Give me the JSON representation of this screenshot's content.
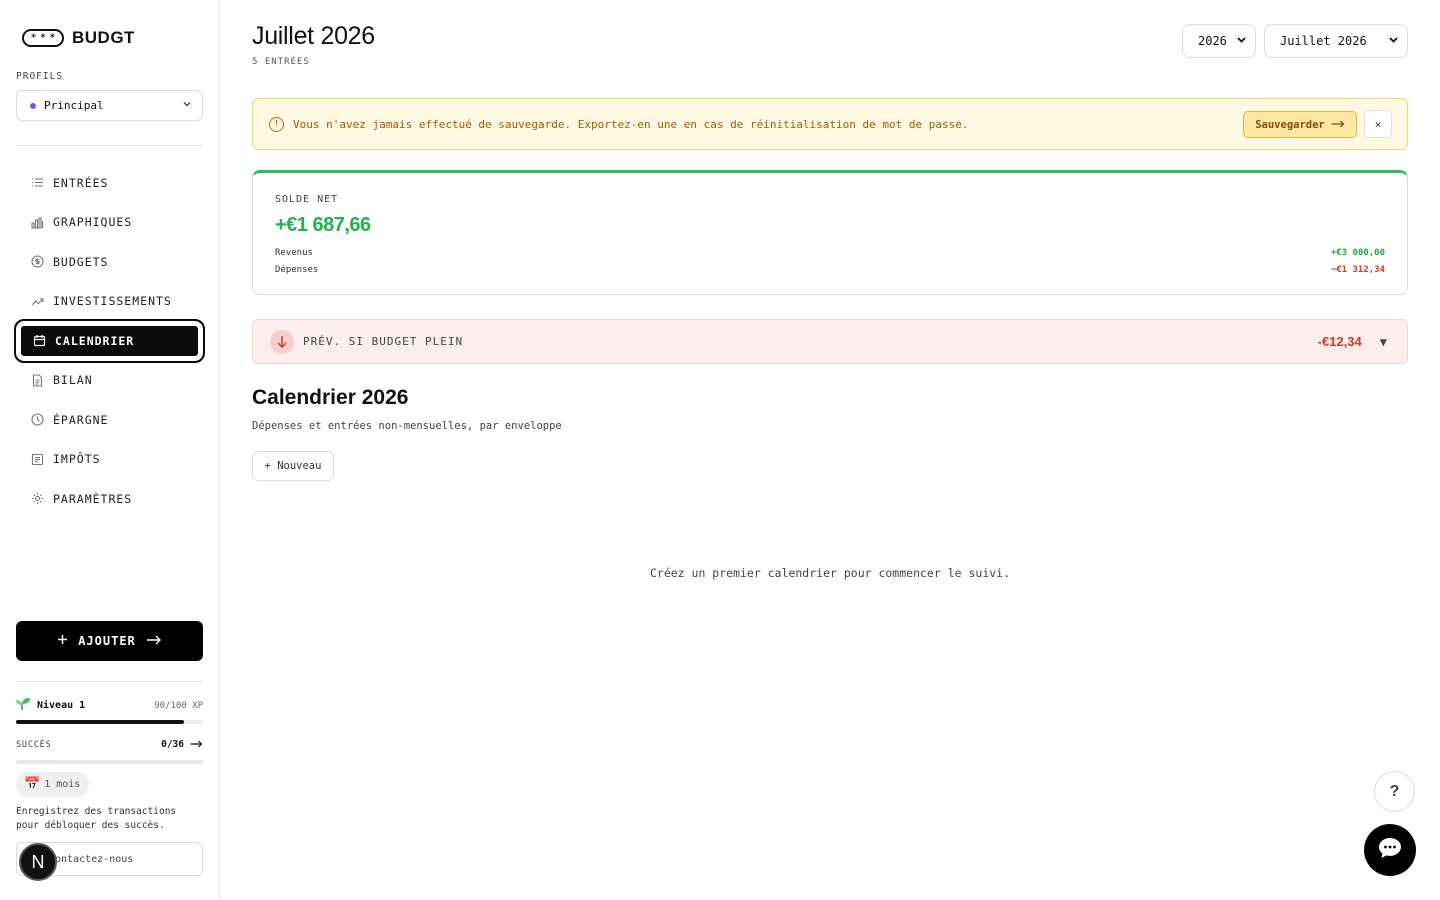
{
  "brand": {
    "logo_dots": "*",
    "name": "BUDGT"
  },
  "sidebar": {
    "profiles_label": "PROFILS",
    "profile": {
      "selected": "Principal",
      "dot_color": "#6d5ce8"
    },
    "items": [
      {
        "label": "ENTRÉES",
        "icon": "list-icon"
      },
      {
        "label": "GRAPHIQUES",
        "icon": "bar-chart-icon"
      },
      {
        "label": "BUDGETS",
        "icon": "coin-icon"
      },
      {
        "label": "INVESTISSEMENTS",
        "icon": "trending-up-icon"
      },
      {
        "label": "CALENDRIER",
        "icon": "calendar-icon",
        "active": true
      },
      {
        "label": "BILAN",
        "icon": "document-icon"
      },
      {
        "label": "ÉPARGNE",
        "icon": "clock-icon"
      },
      {
        "label": "IMPÔTS",
        "icon": "receipt-icon"
      },
      {
        "label": "PARAMÈTRES",
        "icon": "gear-icon"
      }
    ],
    "add_label": "AJOUTER",
    "level": {
      "label": "Niveau 1",
      "xp_text": "90/100 XP",
      "progress": 0.9
    },
    "achievements": {
      "label": "SUCCÈS",
      "count": "0/36",
      "progress": 0.0
    },
    "streak": {
      "icon": "📅",
      "label": "1 mois"
    },
    "achievement_hint": "Enregistrez des transactions pour débloquer des succès.",
    "contact": "Contactez-nous",
    "badge_letter": "N"
  },
  "header": {
    "title": "Juillet 2026",
    "entries_count": "5 ENTRÉES",
    "year_select": "2026",
    "month_select": "Juillet 2026"
  },
  "warning": {
    "text": "Vous n'avez jamais effectué de sauvegarde. Exportez-en une en cas de réinitialisation de mot de passe.",
    "button": "Sauvegarder",
    "close": "×"
  },
  "balance": {
    "label": "SOLDE NET",
    "value": "+€1 687,66",
    "revenue_label": "Revenus",
    "revenue_value": "+€3 000,00",
    "expense_label": "Dépenses",
    "expense_value": "−€1 312,34",
    "accent_color": "#2fbf5b"
  },
  "forecast": {
    "label": "PRÉV. SI BUDGET PLEIN",
    "value": "-€12,34"
  },
  "calendar": {
    "title": "Calendrier 2026",
    "subtitle": "Dépenses et entrées non-mensuelles, par enveloppe",
    "new_button": "+ Nouveau",
    "empty_message": "Créez un premier calendrier pour commencer le suivi."
  },
  "floating": {
    "help": "?"
  }
}
